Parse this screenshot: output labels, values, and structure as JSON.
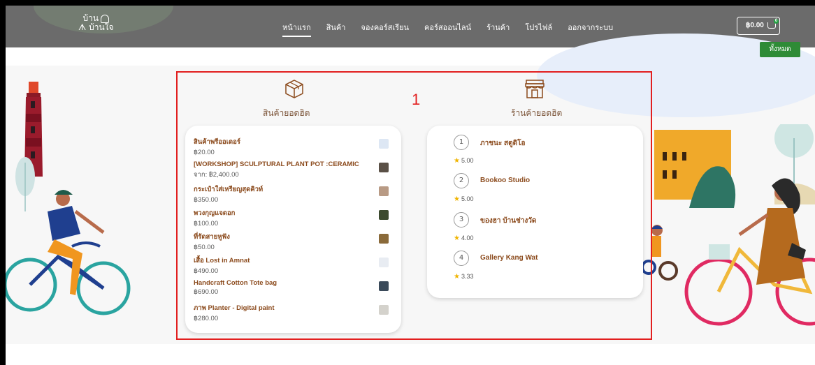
{
  "logo": {
    "line1": "บ้าน",
    "line2": "ᗑ บ้านใจ"
  },
  "nav": {
    "items": [
      {
        "label": "หน้าแรก",
        "active": true
      },
      {
        "label": "สินค้า"
      },
      {
        "label": "จองคอร์สเรียน"
      },
      {
        "label": "คอร์สออนไลน์"
      },
      {
        "label": "ร้านค้า"
      },
      {
        "label": "โปรไฟล์"
      },
      {
        "label": "ออกจากระบบ"
      }
    ]
  },
  "cart": {
    "amount": "฿0.00",
    "badge": "0"
  },
  "all_button": "ทั้งหมด",
  "annotation": "1",
  "products_section": {
    "title": "สินค้ายอดฮิต",
    "items": [
      {
        "name": "สินค้าพรีออเดอร์",
        "price": "฿20.00"
      },
      {
        "name": "[WORKSHOP] SCULPTURAL PLANT POT :CERAMIC",
        "price": "จาก: ฿2,400.00"
      },
      {
        "name": "กระเป๋าใส่เหรียญสุดคิวท์",
        "price": "฿350.00"
      },
      {
        "name": "พวงกุญแจดอก",
        "price": "฿100.00"
      },
      {
        "name": "ที่รัดสายหูฟัง",
        "price": "฿50.00"
      },
      {
        "name": "เสื้อ Lost in Amnat",
        "price": "฿490.00"
      },
      {
        "name": "Handcraft Cotton Tote bag",
        "price": "฿690.00"
      },
      {
        "name": "ภาพ Planter - Digital paint",
        "price": "฿280.00"
      }
    ]
  },
  "shops_section": {
    "title": "ร้านค้ายอดฮิต",
    "items": [
      {
        "rank": "1",
        "name": "ภาชนะ สตูดิโอ",
        "rating": "5.00"
      },
      {
        "rank": "2",
        "name": "Bookoo Studio",
        "rating": "5.00"
      },
      {
        "rank": "3",
        "name": "ของฮา บ้านช่างวัด",
        "rating": "4.00"
      },
      {
        "rank": "4",
        "name": "Gallery Kang Wat",
        "rating": "3.33"
      }
    ]
  },
  "colors": {
    "nav_bg": "#6b6b6b",
    "accent_brown": "#8b4a1c",
    "highlight_red": "#e21f1f",
    "green_button": "#2e8b36",
    "star": "#f0b400"
  }
}
